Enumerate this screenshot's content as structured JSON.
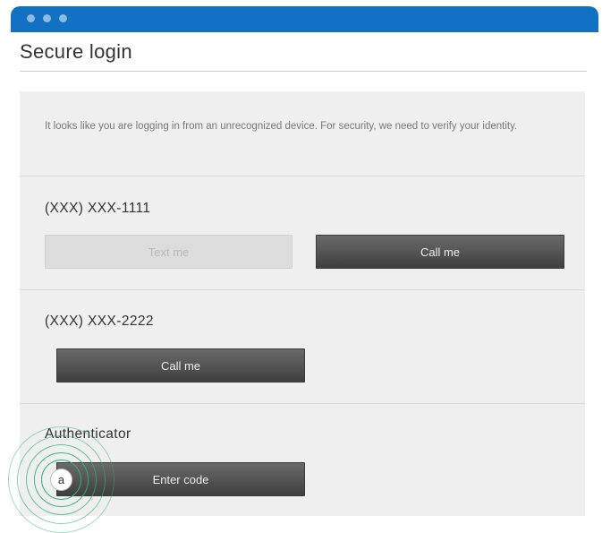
{
  "window": {
    "title_bar_color": "#1271c2",
    "controls": [
      "window-dot",
      "window-dot",
      "window-dot"
    ]
  },
  "page": {
    "title": "Secure login",
    "notice": "It looks like you are logging in from an unrecognized device. For security, we need to verify your identity."
  },
  "options": [
    {
      "label": "(XXX) XXX-1111",
      "text_button": "Text me",
      "call_button": "Call me"
    },
    {
      "label": "(XXX) XXX-2222",
      "call_button": "Call me"
    },
    {
      "label": "Authenticator",
      "enter_button": "Enter code"
    }
  ],
  "annotation": {
    "marker_label": "a",
    "ring_color": "#2fb37a"
  }
}
